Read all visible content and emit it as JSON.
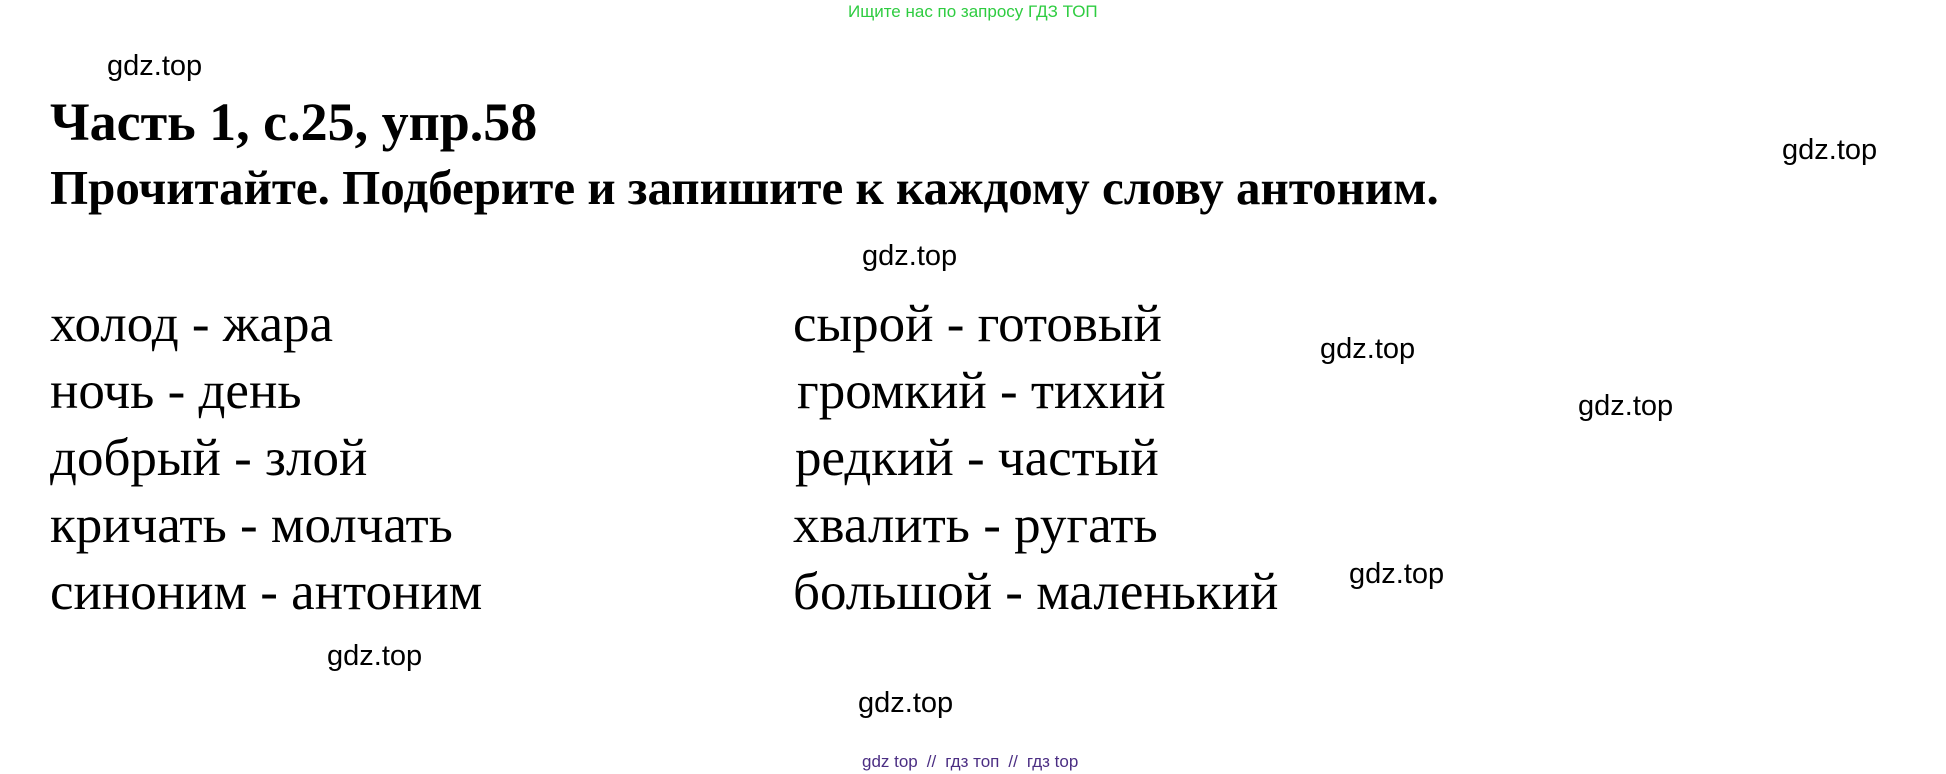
{
  "banner": "Ищите нас по запросу ГДЗ ТОП",
  "watermark": "gdz.top",
  "title": "Часть 1, с.25, упр.58",
  "instruction": "Прочитайте. Подберите и запишите к каждому слову антоним.",
  "left_column": [
    "холод - жара",
    "ночь   - день",
    "добрый - злой",
    "кричать   - молчать",
    "синоним - антоним"
  ],
  "right_column": [
    "сырой - готовый",
    "громкий - тихий",
    "редкий - частый",
    "хвалить - ругать",
    "большой - маленький"
  ],
  "footer": {
    "links": [
      "gdz top",
      "гдз топ",
      "гдз top"
    ],
    "separator": "//"
  },
  "colors": {
    "banner": "#2ecc40",
    "footer": "#4b2e83",
    "text": "#000000"
  }
}
